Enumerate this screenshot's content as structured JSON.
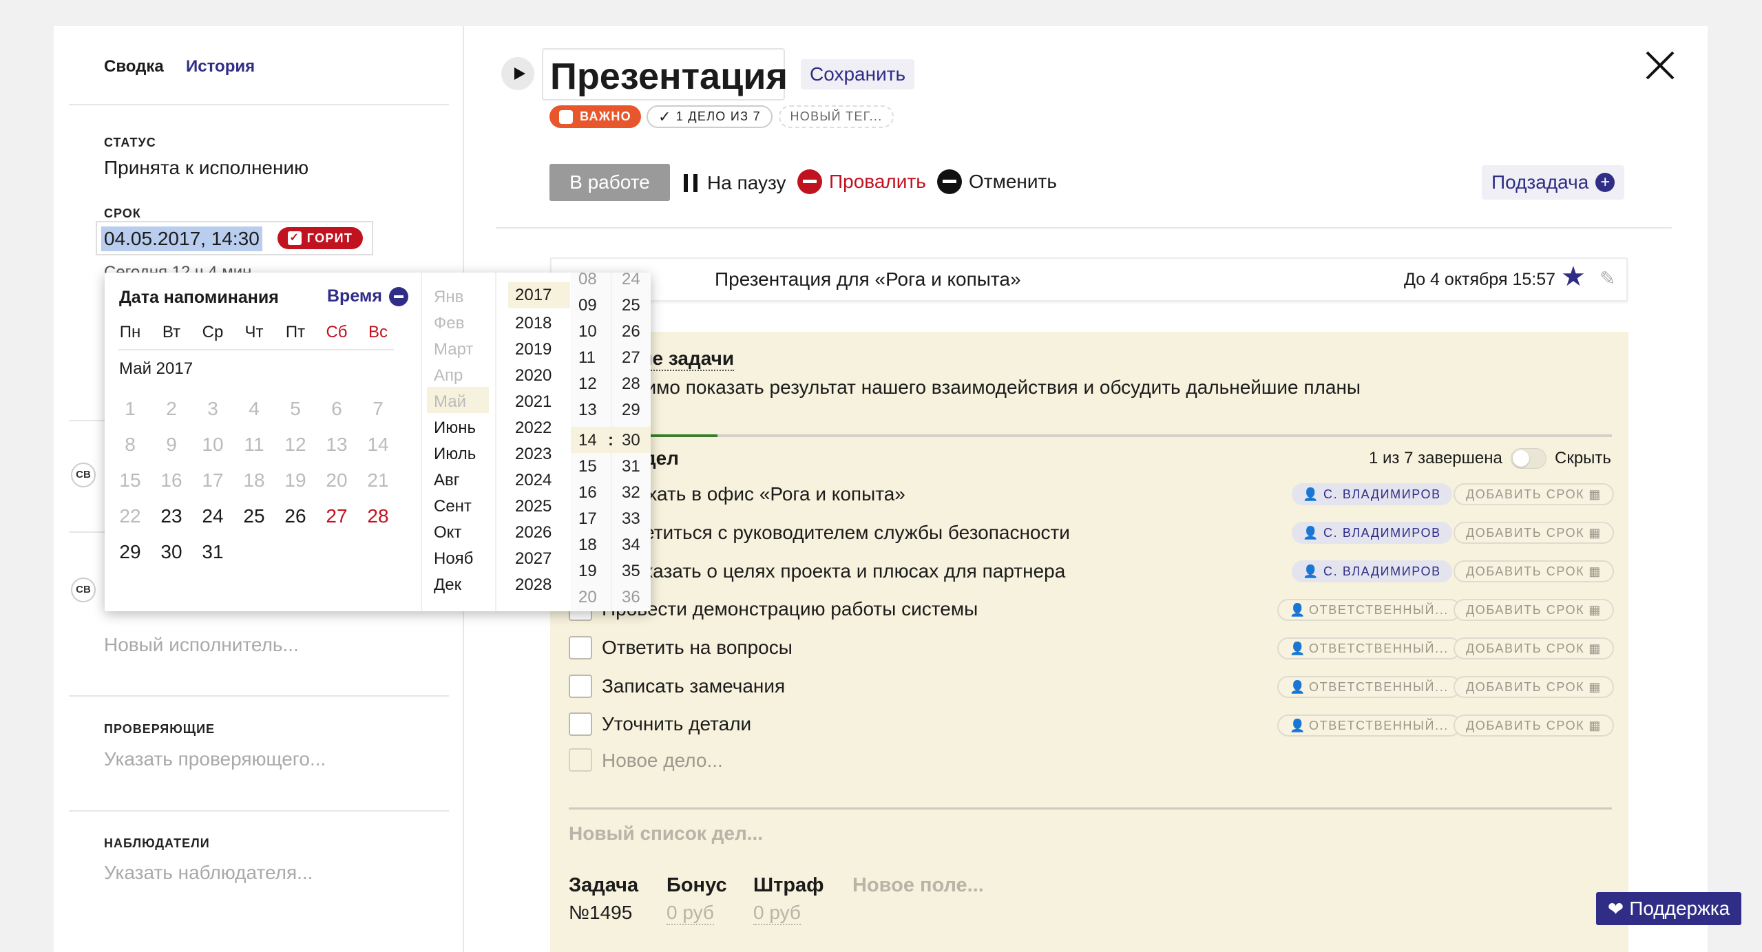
{
  "sidebar": {
    "tabs": [
      {
        "label": "Сводка"
      },
      {
        "label": "История"
      }
    ],
    "status": {
      "label": "СТАТУС",
      "value": "Принята к исполнению"
    },
    "deadline": {
      "label": "СРОК",
      "value": "04.05.2017, 14:30",
      "badge": "ГОРИТ",
      "hint": "Сегодня 12 ч 4 мин"
    },
    "avatars": [
      "СВ",
      "СВ"
    ],
    "new_executor_placeholder": "Новый исполнитель...",
    "reviewers": {
      "label": "ПРОВЕРЯЮЩИЕ",
      "placeholder": "Указать проверяющего..."
    },
    "watchers": {
      "label": "НАБЛЮДАТЕЛИ",
      "placeholder": "Указать наблюдателя..."
    }
  },
  "header": {
    "play_icon": "play-icon",
    "title": "Презентация",
    "save_label": "Сохранить",
    "close_icon": "close-icon",
    "tags": [
      {
        "label": "ВАЖНО",
        "color": "#e8562c"
      },
      {
        "label": "1 ДЕЛО ИЗ 7"
      },
      {
        "label": "НОВЫЙ ТЕГ..."
      }
    ]
  },
  "actions": {
    "in_progress": "В работе",
    "pause": "На паузу",
    "fail": "Провалить",
    "cancel": "Отменить",
    "subtask": "Подзадача"
  },
  "parent_task": {
    "prefix": "Задача:",
    "name": "Презентация для «Рога и копыта»",
    "due": "До 4 октября 15:57"
  },
  "description": {
    "title": "Описание задачи",
    "text": "Необходимо показать результат нашего взаимодействия и обсудить дальнейшие планы"
  },
  "checklist": {
    "title": "Список дел",
    "progress_text": "1 из 7 завершена",
    "progress": 0.143,
    "hide_label": "Скрыть",
    "items": [
      {
        "text": "Приехать в офис «Рога и копыта»",
        "assignee": "С. ВЛАДИМИРОВ",
        "deadline": "ДОБАВИТЬ СРОК"
      },
      {
        "text": "Встретиться с руководителем службы безопасности",
        "assignee": "С. ВЛАДИМИРОВ",
        "deadline": "ДОБАВИТЬ СРОК"
      },
      {
        "text": "Рассказать о целях проекта и плюсах для партнера",
        "assignee": "С. ВЛАДИМИРОВ",
        "deadline": "ДОБАВИТЬ СРОК"
      },
      {
        "text": "Провести демонстрацию работы системы",
        "assignee": "ОТВЕТСТВЕННЫЙ...",
        "deadline": "ДОБАВИТЬ СРОК"
      },
      {
        "text": "Ответить на вопросы",
        "assignee": "ОТВЕТСТВЕННЫЙ...",
        "deadline": "ДОБАВИТЬ СРОК"
      },
      {
        "text": "Записать замечания",
        "assignee": "ОТВЕТСТВЕННЫЙ...",
        "deadline": "ДОБАВИТЬ СРОК"
      },
      {
        "text": "Уточнить детали",
        "assignee": "ОТВЕТСТВЕННЫЙ...",
        "deadline": "ДОБАВИТЬ СРОК"
      }
    ],
    "new_item_placeholder": "Новое дело...",
    "new_list_placeholder": "Новый список дел..."
  },
  "fields": {
    "task_label": "Задача",
    "task_number": "№1495",
    "bonus_label": "Бонус",
    "bonus_value": "0 руб",
    "fine_label": "Штраф",
    "fine_value": "0 руб",
    "new_field": "Новое поле..."
  },
  "support_label": "Поддержка",
  "datepicker": {
    "title": "Дата напоминания",
    "time_label": "Время",
    "weekdays": [
      "Пн",
      "Вт",
      "Ср",
      "Чт",
      "Пт",
      "Сб",
      "Вс"
    ],
    "month_label": "Май 2017",
    "days": [
      [
        "1",
        "2",
        "3",
        "4",
        "5",
        "6",
        "7"
      ],
      [
        "8",
        "9",
        "10",
        "11",
        "12",
        "13",
        "14"
      ],
      [
        "15",
        "16",
        "17",
        "18",
        "19",
        "20",
        "21"
      ],
      [
        "22",
        "23",
        "24",
        "25",
        "26",
        "27",
        "28"
      ],
      [
        "29",
        "30",
        "31"
      ]
    ],
    "months": [
      "Янв",
      "Фев",
      "Март",
      "Апр",
      "Май",
      "Июнь",
      "Июль",
      "Авг",
      "Сент",
      "Окт",
      "Нояб",
      "Дек"
    ],
    "years": [
      "2017",
      "2018",
      "2019",
      "2020",
      "2021",
      "2022",
      "2023",
      "2024",
      "2025",
      "2026",
      "2027",
      "2028"
    ],
    "hours": [
      "08",
      "09",
      "10",
      "11",
      "12",
      "13",
      "14",
      "15",
      "16",
      "17",
      "18",
      "19",
      "20"
    ],
    "minutes": [
      "24",
      "25",
      "26",
      "27",
      "28",
      "29",
      "30",
      "31",
      "32",
      "33",
      "34",
      "35",
      "36"
    ],
    "separator": ":"
  },
  "colors": {
    "accent": "#2f2d86",
    "danger": "#c1121f",
    "task_bg": "#f7f2dd",
    "in_progress_btn": "#9a9a9a",
    "tag_important": "#e8562c"
  }
}
